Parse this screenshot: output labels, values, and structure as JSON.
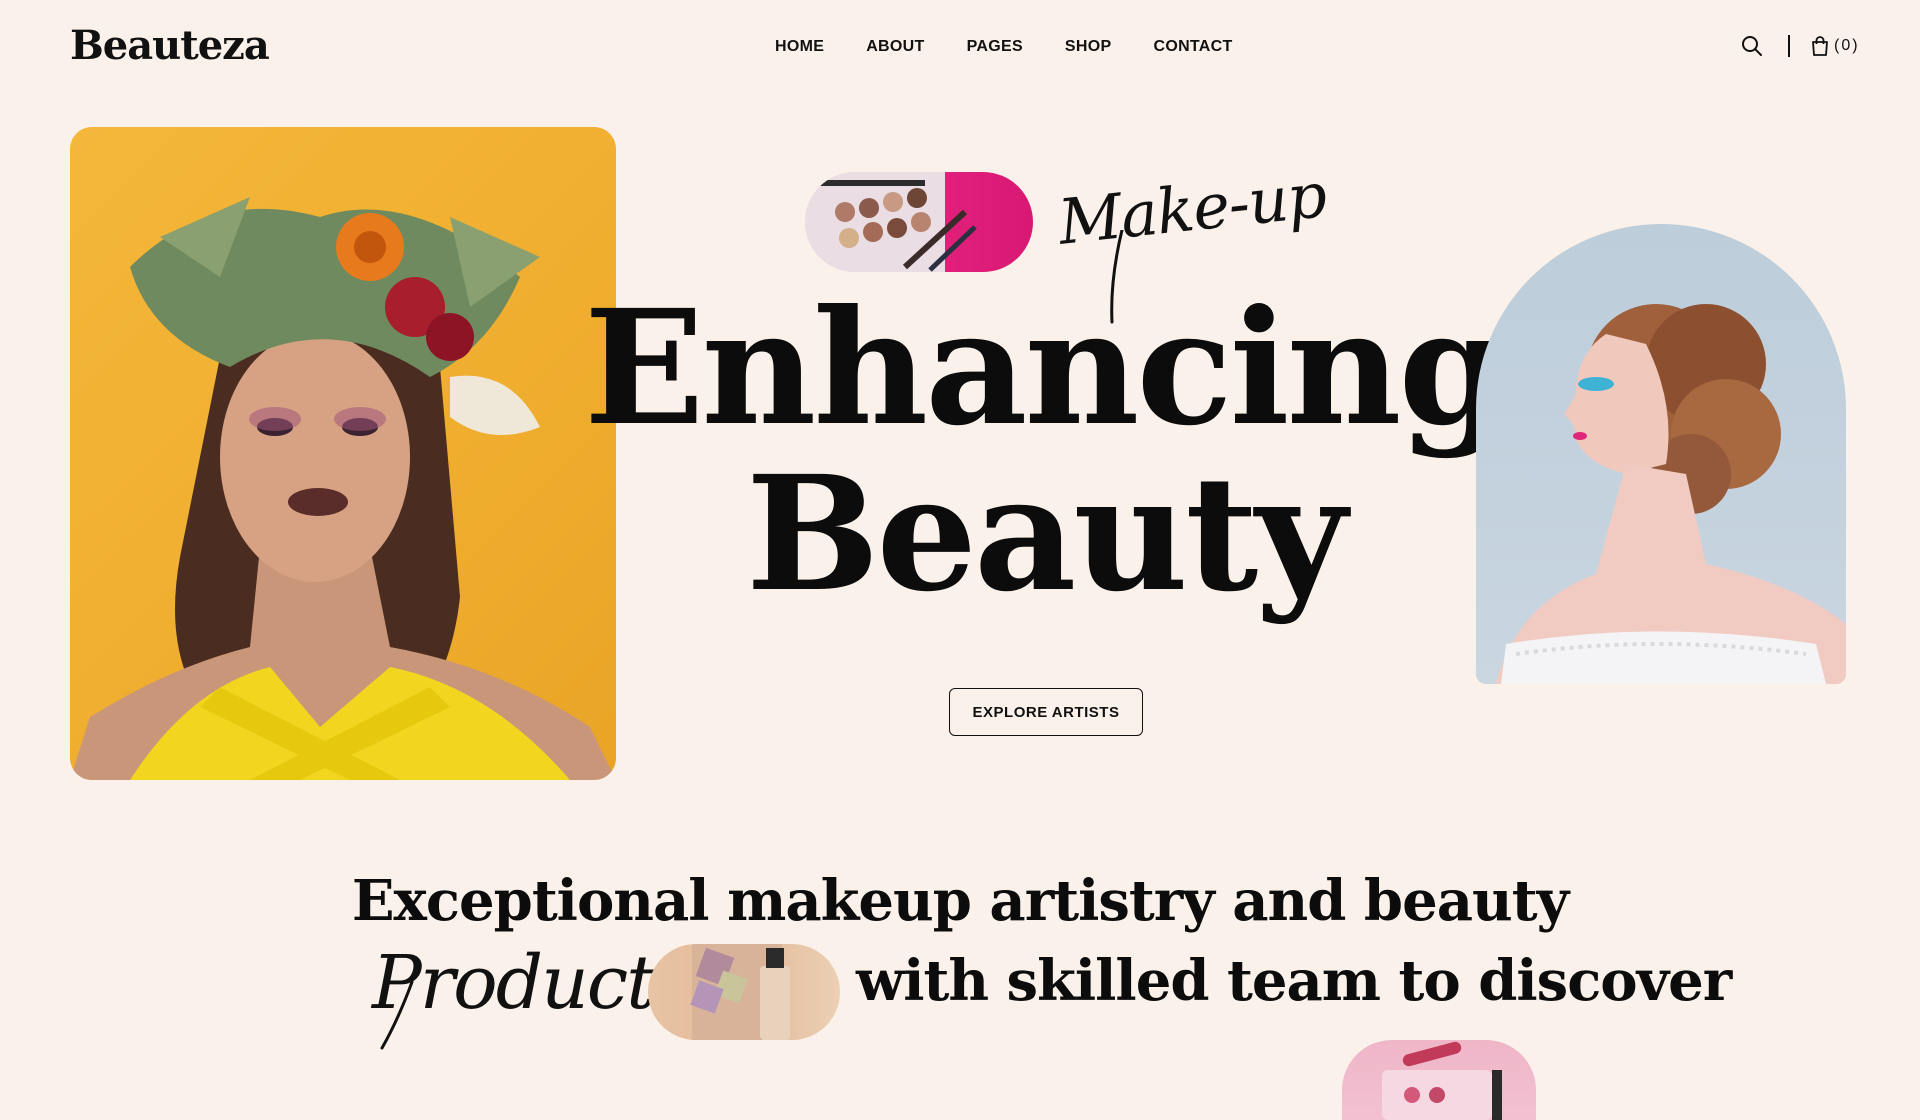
{
  "header": {
    "logo": "Beauteza",
    "nav": [
      {
        "label": "HOME"
      },
      {
        "label": "ABOUT"
      },
      {
        "label": "PAGES"
      },
      {
        "label": "SHOP"
      },
      {
        "label": "CONTACT"
      }
    ],
    "cart_count": "(0)",
    "icons": {
      "search": "search-icon",
      "cart": "shopping-bag-icon"
    }
  },
  "hero": {
    "script_label": "Make-up",
    "title_line1": "Enhancing",
    "title_line2": "Beauty",
    "cta_label": "EXPLORE ARTISTS"
  },
  "tagline": {
    "line1": "Exceptional makeup artistry and beauty",
    "script_word": "Product",
    "line2": "with skilled team to discover"
  },
  "colors": {
    "background": "#faf2ea",
    "text": "#111111",
    "accent_yellow": "#f4b73a",
    "accent_pink": "#e0207a"
  }
}
